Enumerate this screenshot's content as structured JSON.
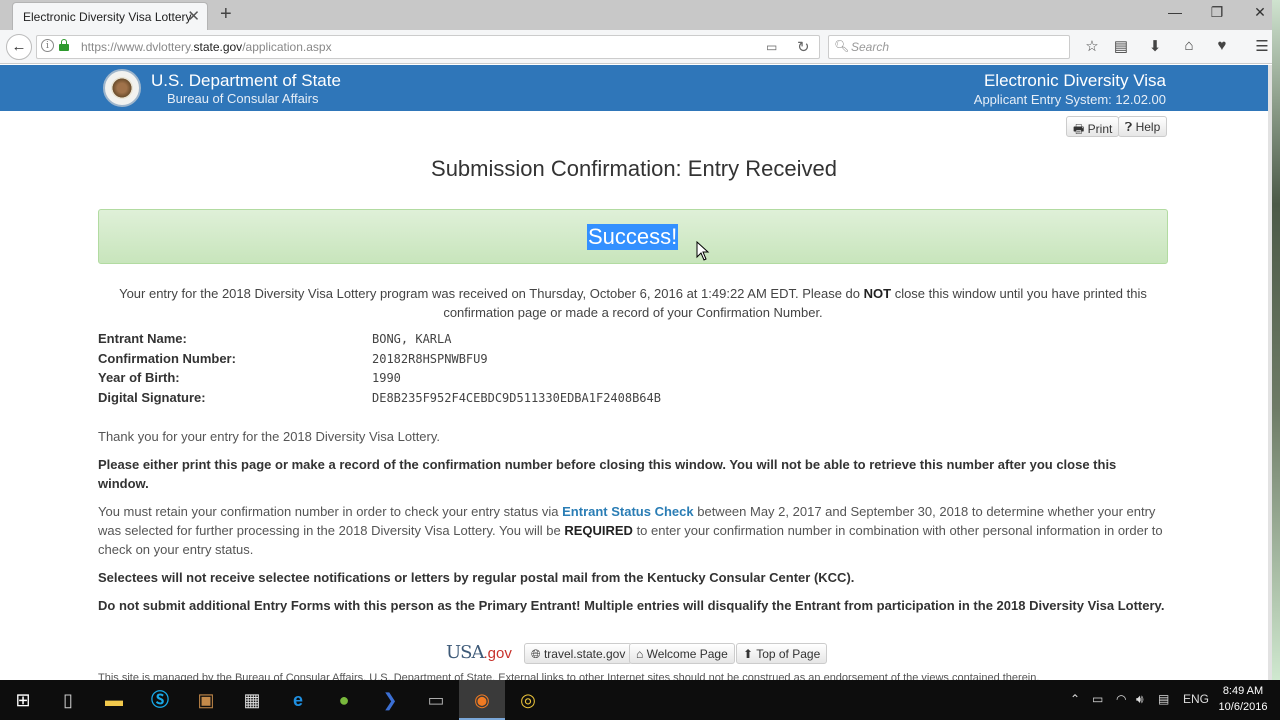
{
  "browser": {
    "tab_title": "Electronic Diversity Visa Lottery",
    "url_prefix": "https://www.dvlottery.",
    "url_domain": "state.gov",
    "url_path": "/application.aspx",
    "search_placeholder": "Search",
    "icons": [
      "back-arrow",
      "info",
      "lock",
      "reader-view",
      "reload",
      "search",
      "bookmark-star",
      "reading-list",
      "download",
      "home",
      "pocket",
      "menu"
    ]
  },
  "header": {
    "department": "U.S. Department of State",
    "bureau": "Bureau of Consular Affairs",
    "system_title": "Electronic Diversity Visa",
    "system_subtitle": "Applicant Entry System: 12.02.00",
    "brand_color": "#2f76b9"
  },
  "actions": {
    "print_label": "Print",
    "help_label": "Help"
  },
  "main": {
    "title": "Submission Confirmation: Entry Received",
    "success_label": "Success!",
    "success_bg": "#dff0d8",
    "intro_part1": "Your entry for the 2018 Diversity Visa Lottery program was received on Thursday, October 6, 2016 at 1:49:22 AM EDT. Please do ",
    "intro_bold": "NOT",
    "intro_part2": " close this window until you have printed this confirmation page or made a record of your Confirmation Number.",
    "details": [
      {
        "label": "Entrant Name:",
        "value": "BONG, KARLA"
      },
      {
        "label": "Confirmation Number:",
        "value": "20182R8HSPNWBFU9"
      },
      {
        "label": "Year of Birth:",
        "value": "1990"
      },
      {
        "label": "Digital Signature:",
        "value": "DE8B235F952F4CEBDC9D511330EDBA1F2408B64B"
      }
    ],
    "thank_you": "Thank you for your entry for the 2018 Diversity Visa Lottery.",
    "print_warning": "Please either print this page or make a record of the confirmation number before closing this window. You will not be able to retrieve this number after you close this window.",
    "retain_part1": "You must retain your confirmation number in order to check your entry status via ",
    "retain_link": "Entrant Status Check",
    "retain_part2": " between May 2, 2017 and September 30, 2018 to determine whether your entry was selected for further processing in the 2018 Diversity Visa Lottery. You will be ",
    "retain_required": "REQUIRED",
    "retain_part3": " to enter your confirmation number in combination with other personal information in order to check on your entry status.",
    "selectees_notice": "Selectees will not receive selectee notifications or letters by regular postal mail from the Kentucky Consular Center (KCC).",
    "multiple_warning": "Do not submit additional Entry Forms with this person as the Primary Entrant! Multiple entries will disqualify the Entrant from participation in the 2018 Diversity Visa Lottery."
  },
  "footer": {
    "usagov_usa": "USA",
    "usagov_gov": ".gov",
    "links": [
      {
        "label": "travel.state.gov",
        "icon": "globe"
      },
      {
        "label": "Welcome Page",
        "icon": "home"
      },
      {
        "label": "Top of Page",
        "icon": "arrow-up"
      }
    ],
    "note": "This site is managed by the Bureau of Consular Affairs, U.S. Department of State. External links to other Internet sites should not be construed as an endorsement of the views contained therein."
  },
  "taskbar": {
    "apps": [
      "start",
      "task-view",
      "file-explorer",
      "skype",
      "app",
      "calculator",
      "edge",
      "utorrent",
      "powershell",
      "command-prompt",
      "firefox",
      "chrome"
    ],
    "active_app": "firefox",
    "language": "ENG",
    "time": "8:49 AM",
    "date": "10/6/2016"
  }
}
